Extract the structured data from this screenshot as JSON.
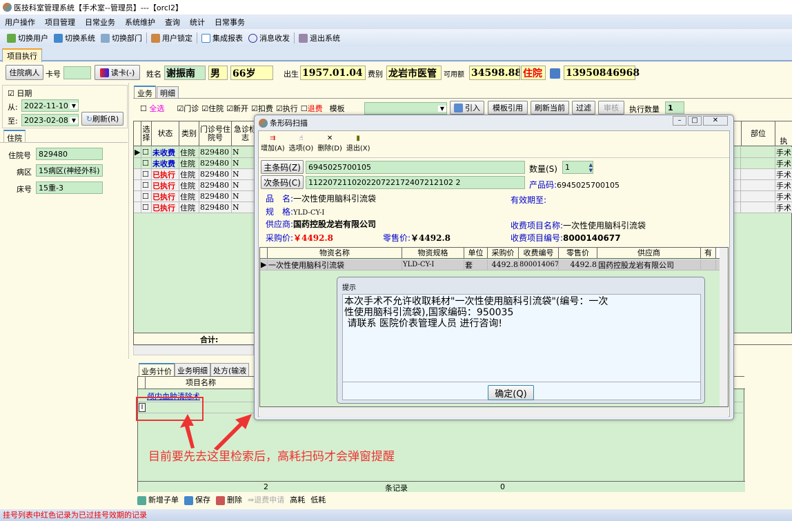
{
  "window": {
    "title": "医技科室管理系统【手术室--管理员】---【orcl2】"
  },
  "menu": [
    "用户操作",
    "项目管理",
    "日常业务",
    "系统维护",
    "查询",
    "统计",
    "日常事务"
  ],
  "toolbar": [
    "切换用户",
    "切换系统",
    "切换部门",
    "用户锁定",
    "集成报表",
    "消息收发",
    "退出系统"
  ],
  "doc_tab": "项目执行",
  "patient": {
    "inpatient_btn": "住院病人",
    "card_label": "卡号",
    "card_value": "",
    "read_card": "读卡(-)",
    "name_label": "姓名",
    "name": "谢振南",
    "sex": "男",
    "age": "66岁",
    "birth_label": "出生",
    "birth": "1957.01.04",
    "fee_label": "费别",
    "fee": "龙岩市医管",
    "avail_label": "可用额",
    "avail": "34598.88",
    "status": "住院",
    "phone": "13950846968"
  },
  "date": {
    "label": "日期",
    "from_label": "从:",
    "from": "2022-11-10",
    "to_label": "至:",
    "to": "2023-02-08",
    "refresh": "刷新(R)"
  },
  "left_tab": "住院",
  "left_fields": [
    {
      "label": "住院号",
      "value": "829480"
    },
    {
      "label": "病区",
      "value": "15病区(神经外科)"
    },
    {
      "label": "床号",
      "value": "15重-3"
    }
  ],
  "biz_tabs": [
    "业务",
    "明细"
  ],
  "filters": {
    "select_all": "全选",
    "outpatient": "门诊",
    "inpatient": "住院",
    "new": "新开",
    "deduct": "扣费",
    "executed": "执行",
    "refund": "退费",
    "template_label": "模板",
    "template_value": "",
    "import": "引入",
    "template_ref": "模板引用",
    "refresh_current": "刷新当前",
    "filter": "过滤",
    "audit": "审核",
    "exec_qty_label": "执行数量",
    "exec_qty": "1"
  },
  "grid": {
    "headers": [
      "选择",
      "状态",
      "类别",
      "门诊号住院号",
      "急诊标志",
      "部位",
      "执"
    ],
    "rows": [
      [
        "未收费",
        "住院",
        "829480",
        "N",
        "手术"
      ],
      [
        "未收费",
        "住院",
        "829480",
        "N",
        "手术"
      ],
      [
        "已执行",
        "住院",
        "829480",
        "N",
        "手术"
      ],
      [
        "已执行",
        "住院",
        "829480",
        "N",
        "手术"
      ],
      [
        "已执行",
        "住院",
        "829480",
        "N",
        "手术"
      ],
      [
        "已执行",
        "住院",
        "829480",
        "N",
        "手术"
      ]
    ],
    "total_label": "合计:"
  },
  "bottom": {
    "tabs": [
      "业务计价",
      "业务明细",
      "处方(输液"
    ],
    "header": "项目名称",
    "rows": [
      "颅内血肿清除术",
      ""
    ],
    "footer": [
      "2",
      "条记录",
      "0"
    ],
    "actions": [
      "新增子单",
      "保存",
      "删除",
      "退费申请",
      "高耗",
      "低耗"
    ]
  },
  "status_bar": "挂号列表中红色记录为已过挂号效期的记录",
  "annotation": "目前要先去这里检索后，高耗扫码才会弹窗提醒",
  "scan_dialog": {
    "title": "条形码扫描",
    "tools": [
      "增加(A)",
      "选项(O)",
      "删除(D)",
      "退出(X)"
    ],
    "main_code_label": "主条码(Z)",
    "main_code": "6945025700105",
    "qty_label": "数量(S)",
    "qty": "1",
    "sub_code_label": "次条码(C)",
    "sub_code": "112207211020220722172407212102 2",
    "product_code_label": "产品码:",
    "product_code": "6945025700105",
    "name_label": "品　名:",
    "name": "一次性使用脑科引流袋",
    "expiry_label": "有效期至:",
    "expiry": "",
    "spec_label": "规　格:",
    "spec": "YLD-CY-I",
    "supplier_label": "供应商:",
    "supplier": "国药控股龙岩有限公司",
    "fee_item_name_label": "收费项目名称:",
    "fee_item_name": "一次性使用脑科引流袋",
    "purchase_label": "采购价:",
    "purchase": "￥4492.8",
    "retail_label": "零售价:",
    "retail": "￥4492.8",
    "fee_item_code_label": "收费项目编号:",
    "fee_item_code": "8000140677",
    "table_headers": [
      "物资名称",
      "物资规格",
      "单位",
      "采购价",
      "收费编号",
      "零售价",
      "供应商",
      "有"
    ],
    "table_rows": [
      [
        "一次性使用脑科引流袋",
        "YLD-CY-I",
        "套",
        "4492.8",
        "8000140677",
        "4492.8",
        "国药控股龙岩有限公司",
        ""
      ]
    ]
  },
  "message": {
    "title": "提示",
    "line1": "本次手术不允许收取耗材\"一次性使用脑科引流袋\"(编号：一次",
    "line2": "性使用脑科引流袋),国家编码：950035",
    "line3": " 请联系 医院价表管理人员 进行咨询!",
    "ok": "确定(Q)"
  }
}
